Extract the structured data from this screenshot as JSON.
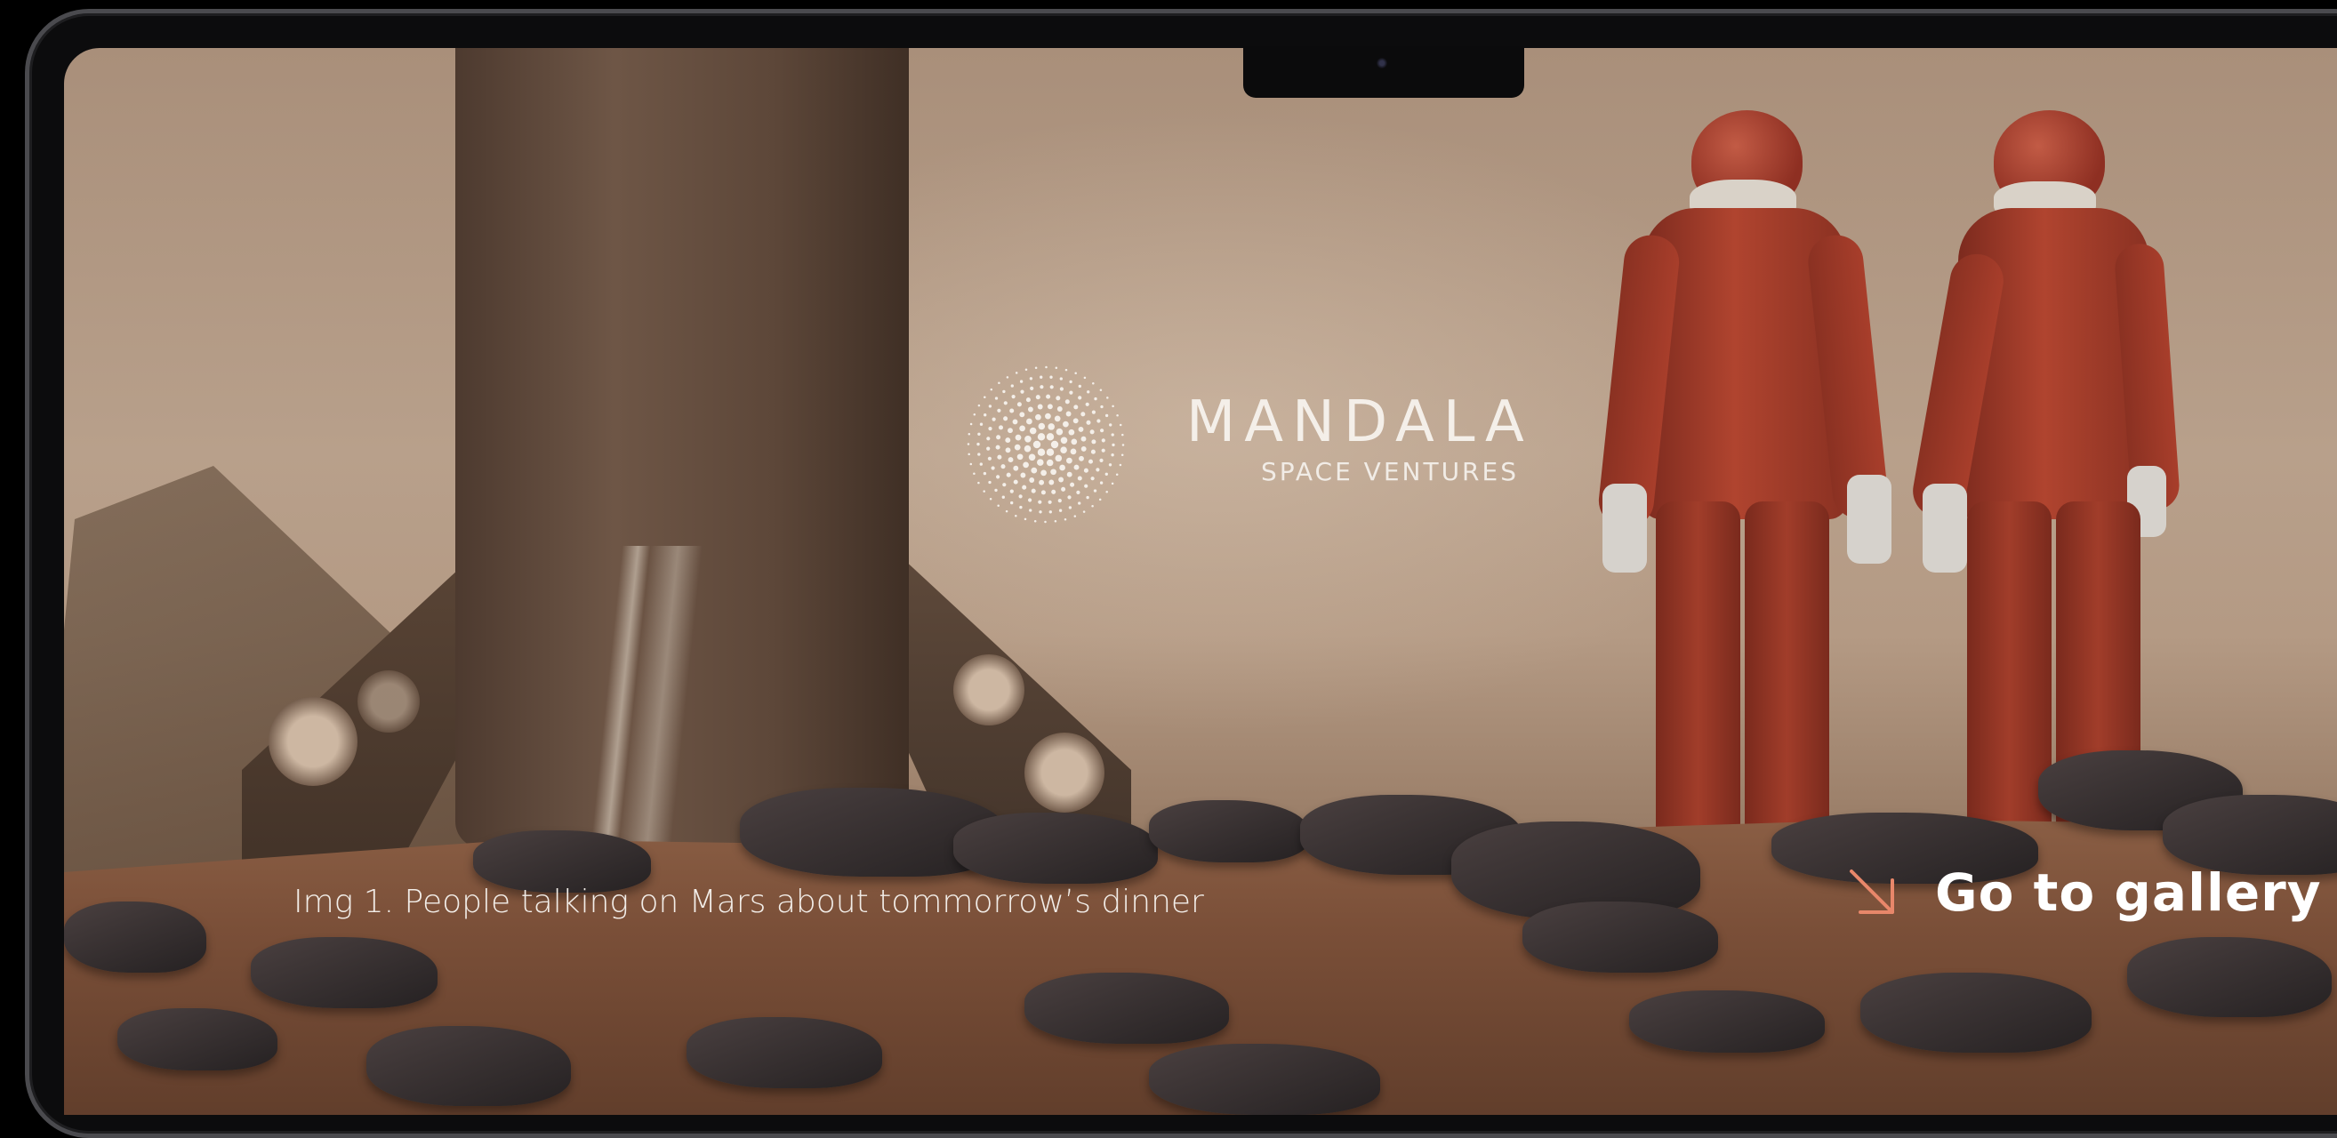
{
  "brand": {
    "name": "MANDALA",
    "tagline": "SPACE VENTURES",
    "logo_icon": "dotted-sphere-icon"
  },
  "hero": {
    "background": "astronauts-on-mars-photo",
    "caption": "Img 1. People talking on Mars about tommorrow’s dinner"
  },
  "gallery_link": {
    "label": "Go to gallery",
    "icon": "arrow-down-right-icon",
    "icon_color": "#e8876a"
  },
  "colors": {
    "text": "#ffffff",
    "accent": "#e8876a"
  }
}
